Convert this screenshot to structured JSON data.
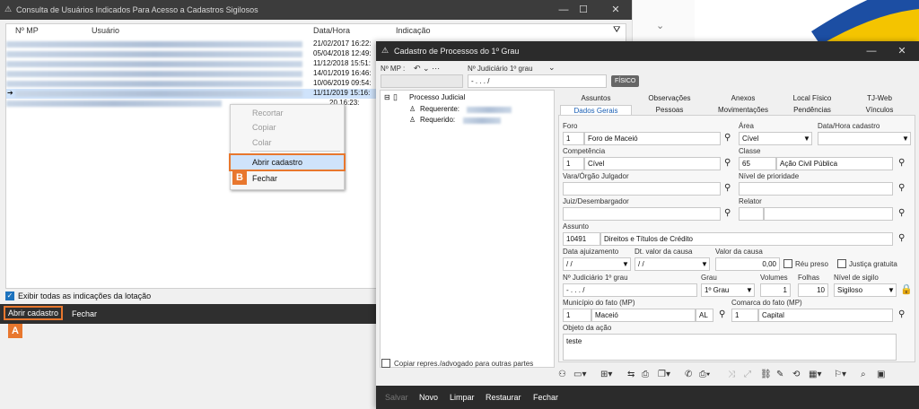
{
  "consulta": {
    "title": "Consulta de Usuários Indicados Para Acesso a Cadastros Sigilosos",
    "cols": {
      "nmp": "Nº MP",
      "usuario": "Usuário",
      "data": "Data/Hora",
      "indicacao": "Indicação"
    },
    "rows": [
      "21/02/2017 16:22:",
      "05/04/2018 12:49:",
      "11/12/2018 15:51:",
      "14/01/2019 16:46:",
      "10/06/2019 09:54:",
      "11/11/2019 15:16:",
      "20 16:23:"
    ],
    "checkbox_label": "Exibir todas as indicações da lotação",
    "btn_abrir": "Abrir cadastro",
    "btn_fechar": "Fechar",
    "badge_a": "A",
    "badge_b": "B"
  },
  "context_menu": {
    "recortar": "Recortar",
    "copiar": "Copiar",
    "colar": "Colar",
    "abrir": "Abrir cadastro",
    "fechar": "Fechar"
  },
  "cadastro": {
    "title": "Cadastro de Processos do 1º Grau",
    "nmp_label": "Nº MP :",
    "nj_label": "Nº Judiciário  1º grau",
    "nj_value": "-  .  . .  /",
    "fisico": "FÍSICO",
    "tree": {
      "root": "Processo Judicial",
      "req1": "Requerente:",
      "req2": "Requerido:"
    },
    "copiar_label": "Copiar repres./advogado para outras partes",
    "tabs_top": [
      "Assuntos",
      "Observações",
      "Anexos",
      "Local Físico",
      "TJ-Web"
    ],
    "tabs_bottom": [
      "Dados Gerais",
      "Pessoas",
      "Movimentações",
      "Pendências",
      "Vínculos"
    ],
    "foro": {
      "label": "Foro",
      "code": "1",
      "value": "Foro de Maceió"
    },
    "area": {
      "label": "Área",
      "value": "Cível"
    },
    "data_cad": {
      "label": "Data/Hora cadastro"
    },
    "competencia": {
      "label": "Competência",
      "code": "1",
      "value": "Cível"
    },
    "classe": {
      "label": "Classe",
      "code": "65",
      "value": "Ação Civil Pública"
    },
    "vara_label": "Vara/Órgão Julgador",
    "prioridade_label": "Nível de prioridade",
    "juiz_label": "Juiz/Desembargador",
    "relator_label": "Relator",
    "assunto": {
      "label": "Assunto",
      "code": "10491",
      "value": "Direitos e Títulos de Crédito"
    },
    "data_ajuiz": {
      "label": "Data ajuizamento",
      "value": "/ /"
    },
    "dt_valor": {
      "label": "Dt. valor da causa",
      "value": "/ /"
    },
    "valor": {
      "label": "Valor da causa",
      "value": "0,00"
    },
    "reu_preso": "Réu preso",
    "justica_gratuita": "Justiça gratuita",
    "nj2": {
      "label": "Nº Judiciário  1º grau",
      "value": "-  .  . .  /"
    },
    "grau": {
      "label": "Grau",
      "value": "1º Grau"
    },
    "volumes": {
      "label": "Volumes",
      "value": "1"
    },
    "folhas": {
      "label": "Folhas",
      "value": "10"
    },
    "sigilo": {
      "label": "Nível de sigilo",
      "value": "Sigiloso"
    },
    "municipio": {
      "label": "Município do fato (MP)",
      "code": "1",
      "value": "Maceió",
      "uf": "AL"
    },
    "comarca": {
      "label": "Comarca do fato (MP)",
      "code": "1",
      "value": "Capital"
    },
    "objeto": {
      "label": "Objeto da ação",
      "value": "teste"
    },
    "bottom": {
      "salvar": "Salvar",
      "novo": "Novo",
      "limpar": "Limpar",
      "restaurar": "Restaurar",
      "fechar": "Fechar"
    }
  },
  "colors": {
    "accent": "#e8772e",
    "selection": "#cfe3fb",
    "dark": "#2b2b2b"
  }
}
